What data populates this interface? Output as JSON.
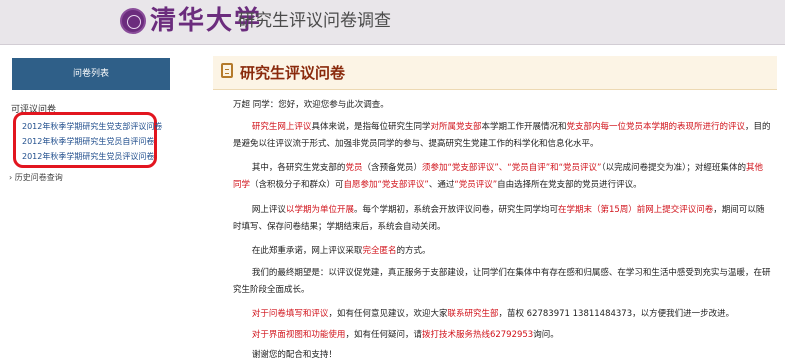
{
  "header": {
    "logo_text": "清华大学",
    "system_title": "研究生评议问卷调查"
  },
  "sidebar": {
    "tab_label": "问卷列表",
    "section_label": "可评议问卷",
    "links": [
      "2012年秋季学期研究生党支部评议问卷",
      "2012年秋季学期研究生党员自评问卷",
      "2012年秋季学期研究生党员评议问卷"
    ],
    "history_label": "历史问卷查询"
  },
  "main": {
    "title": "研究生评议问卷",
    "greeting": "万超 同学：您好，欢迎您参与此次调查。",
    "p1": {
      "a": "研究生网上评议",
      "b": "具体来说，是指每位研究生同学",
      "c": "对所属党支部",
      "d": "本学期工作开展情况和",
      "e": "党支部内每一位党员本学期的表现",
      "f": "所进行的评议",
      "g": "，目的是避免以往评议流于形式、加强非党员同学的参与、提高研究生党建工作的科学化和信息化水平。"
    },
    "p2": {
      "a": "其中，各研究生党支部的",
      "b": "党员",
      "c": "（含预备党员）",
      "d": "须参加",
      "e": "“党支部评议”、“党员自评”和“党员评议”",
      "f": "（以完成问卷提交为准）；对經",
      "g": "班集体的",
      "h": "其他同学",
      "i": "（含积极分子和群众）可",
      "j": "自愿参加“党支部评议”",
      "k": "、通过",
      "l": "“党员评议”",
      "m": "自由选择所在党支部的党员进行评议。"
    },
    "p3": {
      "a": "网上评议",
      "b": "以学期为单位开展",
      "c": "。每个学期初，系统会开放评议问卷，研究生同学均可",
      "d": "在学期末（第15周）前网上提交评议问卷",
      "e": "，期间可",
      "f": "以随时填写、保存问卷结果；学期结束后，系统会自动关闭。"
    },
    "p4": {
      "a": "在此郑重承诺，网上评议采取",
      "b": "完全匿名",
      "c": "的方式。"
    },
    "p5": {
      "a": "我们的最终期望是：以评议促党建，真正服务于支部建设，让同学们在集体中有存在感和归属感、在学习和生活中感受到充实与温",
      "b": "暖，在研究生阶段全面成长。"
    },
    "p6": {
      "a": "对于问卷填写和评议",
      "b": "，如有任何意见建议，欢迎大家",
      "c": "联系研究生部",
      "d": "，苗权  62783971 13811484373，以方便我们进一步改进。"
    },
    "p7": {
      "a": "对于界面视图和功能使用",
      "b": "，如有任何疑问，请",
      "c": "拨打技术服务热线62792953",
      "d": "询问。"
    },
    "thanks": "谢谢您的配合和支持！"
  },
  "colors": {
    "accent_purple": "#6b2c7d",
    "sidebar_blue": "#2f5f88",
    "emphasis_red": "#d1131b",
    "title_brown": "#8a2a0c",
    "highlight_box": "#e2151f"
  }
}
